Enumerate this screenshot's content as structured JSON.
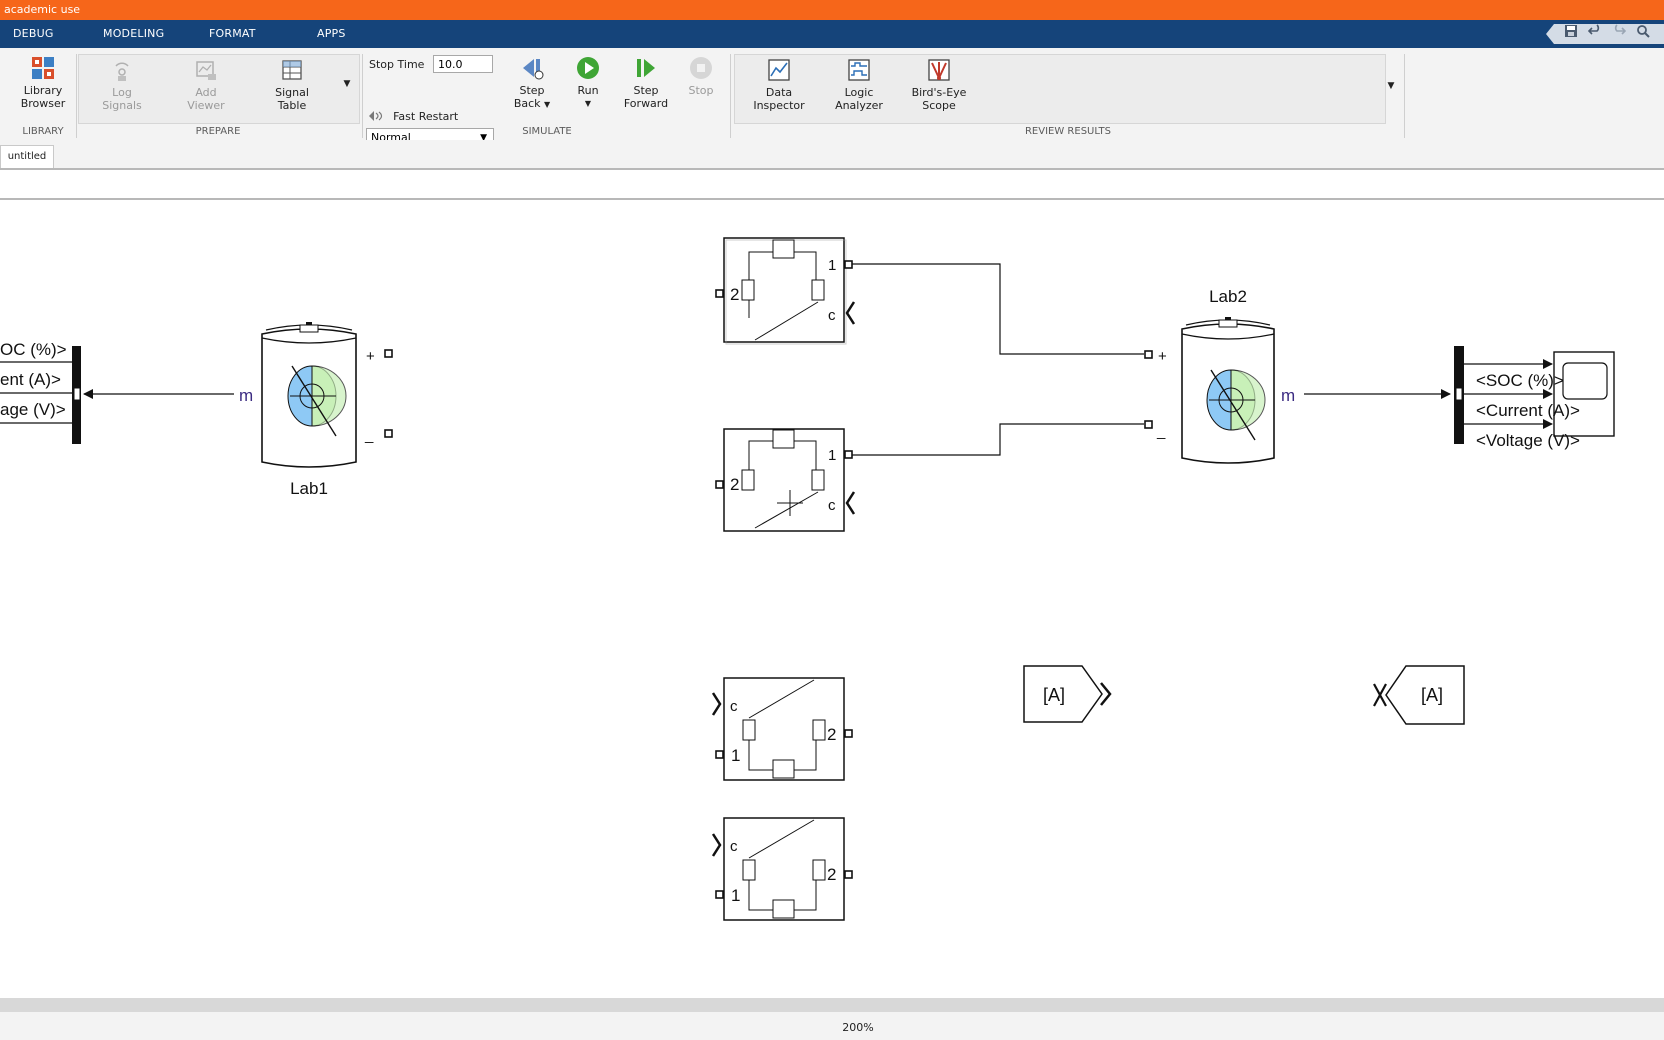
{
  "titlebar": {
    "text": "academic use"
  },
  "tabs": {
    "debug": "DEBUG",
    "modeling": "MODELING",
    "format": "FORMAT",
    "apps": "APPS"
  },
  "ribbon": {
    "library": {
      "button_line1": "Library",
      "button_line2": "Browser",
      "section": "LIBRARY"
    },
    "prepare": {
      "log_line1": "Log",
      "log_line2": "Signals",
      "add_line1": "Add",
      "add_line2": "Viewer",
      "signal_line1": "Signal",
      "signal_line2": "Table",
      "section": "PREPARE"
    },
    "simulate": {
      "stop_time_label": "Stop Time",
      "stop_time_value": "10.0",
      "mode_value": "Normal",
      "fast_restart": "Fast Restart",
      "step_back_line1": "Step",
      "step_back_line2": "Back",
      "run": "Run",
      "step_forward_line1": "Step",
      "step_forward_line2": "Forward",
      "stop": "Stop",
      "section": "SIMULATE"
    },
    "review": {
      "data_line1": "Data",
      "data_line2": "Inspector",
      "logic_line1": "Logic",
      "logic_line2": "Analyzer",
      "birds_line1": "Bird's-Eye",
      "birds_line2": "Scope",
      "section": "REVIEW RESULTS"
    }
  },
  "document_tab": "untitled",
  "canvas": {
    "left_bus": {
      "soc": "OC (%)>",
      "current": "ent (A)>",
      "voltage": "age (V)>"
    },
    "lab1": {
      "name": "Lab1",
      "port_m": "m",
      "port_plus": "+",
      "port_minus": "_"
    },
    "lab2": {
      "name": "Lab2",
      "port_m": "m",
      "port_plus": "+",
      "port_minus": "_"
    },
    "switches": {
      "port1": "1",
      "port2": "2",
      "portc": "c"
    },
    "right_bus": {
      "soc": "<SOC (%)>",
      "current": "<Current (A)>",
      "voltage": "<Voltage (V)>"
    },
    "goto": {
      "tag": "[A]"
    },
    "from": {
      "tag": "[A]"
    }
  },
  "status": {
    "zoom": "200%"
  },
  "colors": {
    "titlebar": "#f6661a",
    "tabbar": "#15447a",
    "port_label": "#3b2b82",
    "battery_blue": "#8ec9f5",
    "battery_green": "#c8f0b8"
  }
}
